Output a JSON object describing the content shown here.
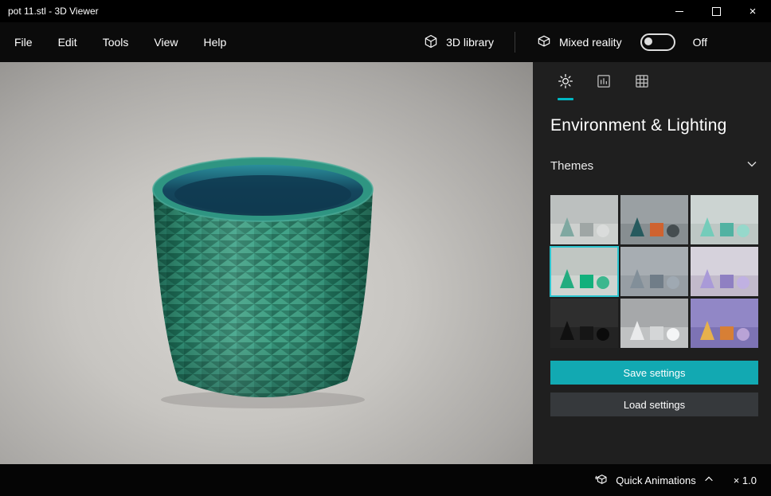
{
  "window": {
    "title": "pot 11.stl - 3D Viewer",
    "close_glyph": "×"
  },
  "menubar": {
    "items": [
      "File",
      "Edit",
      "Tools",
      "View",
      "Help"
    ],
    "library_label": "3D library",
    "mixed_reality_label": "Mixed reality",
    "mixed_reality_state": "Off"
  },
  "panel": {
    "title": "Environment & Lighting",
    "themes_label": "Themes",
    "save_button": "Save settings",
    "load_button": "Load settings",
    "themes": [
      {
        "wall": "#bcc0bf",
        "floor": "#cdd0ce",
        "cone": "#7fa8a1",
        "cube": "#9fa6a5",
        "sphere": "#dadcdb",
        "selected": false
      },
      {
        "wall": "#9aa0a3",
        "floor": "#878e91",
        "cone": "#265a5e",
        "cube": "#cf6330",
        "sphere": "#454d50",
        "selected": false
      },
      {
        "wall": "#ccd4d2",
        "floor": "#bdc7c4",
        "cone": "#74ccba",
        "cube": "#52b2a2",
        "sphere": "#96d8cb",
        "selected": false
      },
      {
        "wall": "#c0c6c2",
        "floor": "#cfd4d0",
        "cone": "#23ac7f",
        "cube": "#12b07c",
        "sphere": "#3cb78e",
        "selected": true
      },
      {
        "wall": "#a7adb2",
        "floor": "#979ea4",
        "cone": "#828f99",
        "cube": "#707d88",
        "sphere": "#9fa9b2",
        "selected": false
      },
      {
        "wall": "#d6d2dc",
        "floor": "#c2bacb",
        "cone": "#a99ad8",
        "cube": "#8f80c2",
        "sphere": "#c0b1e2",
        "selected": false
      },
      {
        "wall": "#2e2e2e",
        "floor": "#232323",
        "cone": "#101010",
        "cube": "#161616",
        "sphere": "#0b0b0b",
        "selected": false
      },
      {
        "wall": "#a6a8aa",
        "floor": "#c0c2c3",
        "cone": "#e9eaeb",
        "cube": "#d4d6d7",
        "sphere": "#f4f5f6",
        "selected": false
      },
      {
        "wall": "#9187c6",
        "floor": "#7d73b4",
        "cone": "#e7b14c",
        "cube": "#d77f35",
        "sphere": "#b9a3d6",
        "selected": false
      }
    ]
  },
  "statusbar": {
    "quick_animations_label": "Quick Animations",
    "speed_label": "× 1.0"
  },
  "colors": {
    "accent": "#00b7c3",
    "accent_button": "#12a9b2",
    "model_color": "#2f9478"
  }
}
